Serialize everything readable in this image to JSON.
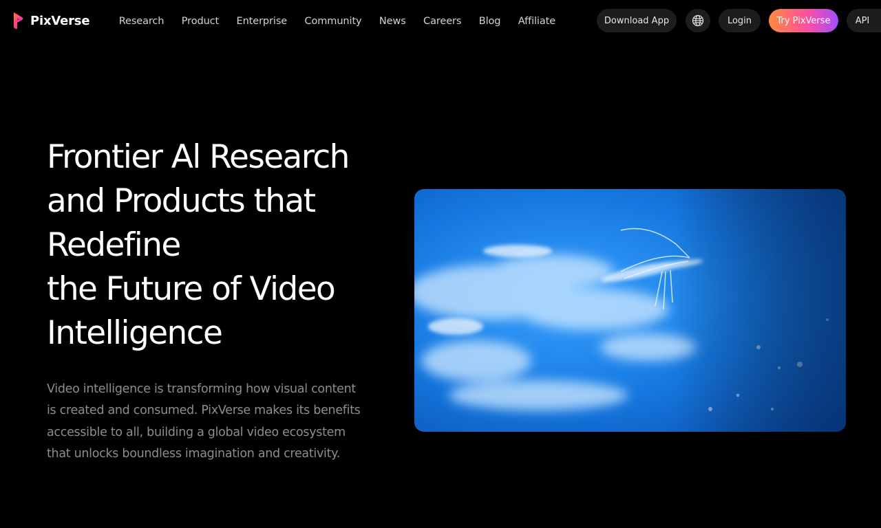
{
  "brand": {
    "name": "PixVerse",
    "logo_icon": "pixverse-logo-icon"
  },
  "nav": {
    "items": [
      {
        "label": "Research"
      },
      {
        "label": "Product"
      },
      {
        "label": "Enterprise"
      },
      {
        "label": "Community"
      },
      {
        "label": "News"
      },
      {
        "label": "Careers"
      },
      {
        "label": "Blog"
      },
      {
        "label": "Affiliate"
      }
    ]
  },
  "actions": {
    "download": "Download App",
    "language_icon": "globe-icon",
    "login": "Login",
    "try": "Try PixVerse",
    "api": "API"
  },
  "hero": {
    "title_lines": [
      "Frontier Al Research",
      "and Products that",
      "Redefine",
      "the Future of Video",
      "Intelligence"
    ],
    "description": "Video intelligence is transforming how visual content is created and consumed. PixVerse makes its benefits accessible to all, building a global video ecosystem that unlocks boundless imagination and creativity."
  },
  "colors": {
    "background": "#000000",
    "pill_bg": "#1d1d1f",
    "try_gradient_start": "#ff8a3d",
    "try_gradient_end": "#a24dff",
    "video_blue": "#0a5cc4",
    "description_text": "#8d8d8d"
  }
}
